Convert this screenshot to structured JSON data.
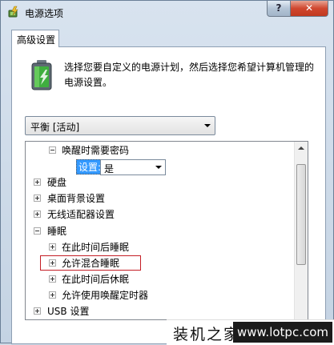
{
  "window": {
    "title": "电源选项",
    "help_glyph": "?",
    "close_glyph": "✕"
  },
  "tab": {
    "label": "高级设置"
  },
  "description": "选择您要自定义的电源计划，然后选择您希望计算机管理的电源设置。",
  "plan_select": {
    "value": "平衡 [活动]"
  },
  "tree": {
    "items": [
      {
        "label": "唤醒时需要密码",
        "expander": "minus"
      },
      {
        "label": "硬盘",
        "expander": "plus"
      },
      {
        "label": "桌面背景设置",
        "expander": "plus"
      },
      {
        "label": "无线适配器设置",
        "expander": "plus"
      },
      {
        "label": "睡眠",
        "expander": "minus"
      },
      {
        "label": "在此时间后睡眠",
        "expander": "plus"
      },
      {
        "label": "允许混合睡眠",
        "expander": "plus",
        "highlighted": true
      },
      {
        "label": "在此时间后休眠",
        "expander": "plus"
      },
      {
        "label": "允许使用唤醒定时器",
        "expander": "plus"
      },
      {
        "label": "USB 设置",
        "expander": "plus"
      }
    ],
    "setting": {
      "label": "设置:",
      "value": "是"
    }
  },
  "watermark": {
    "brand": "装机之家",
    "url": "www.lotpc.com"
  },
  "colors": {
    "selection": "#3399ff",
    "highlight_border": "#c41e25",
    "close_button": "#c9412a"
  }
}
